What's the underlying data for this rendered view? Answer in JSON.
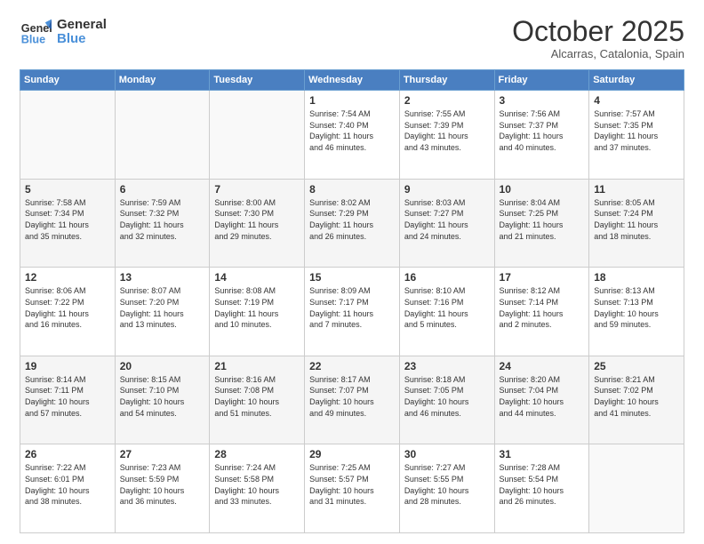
{
  "logo": {
    "line1": "General",
    "line2": "Blue"
  },
  "header": {
    "month": "October 2025",
    "location": "Alcarras, Catalonia, Spain"
  },
  "weekdays": [
    "Sunday",
    "Monday",
    "Tuesday",
    "Wednesday",
    "Thursday",
    "Friday",
    "Saturday"
  ],
  "weeks": [
    [
      {
        "day": "",
        "info": ""
      },
      {
        "day": "",
        "info": ""
      },
      {
        "day": "",
        "info": ""
      },
      {
        "day": "1",
        "info": "Sunrise: 7:54 AM\nSunset: 7:40 PM\nDaylight: 11 hours\nand 46 minutes."
      },
      {
        "day": "2",
        "info": "Sunrise: 7:55 AM\nSunset: 7:39 PM\nDaylight: 11 hours\nand 43 minutes."
      },
      {
        "day": "3",
        "info": "Sunrise: 7:56 AM\nSunset: 7:37 PM\nDaylight: 11 hours\nand 40 minutes."
      },
      {
        "day": "4",
        "info": "Sunrise: 7:57 AM\nSunset: 7:35 PM\nDaylight: 11 hours\nand 37 minutes."
      }
    ],
    [
      {
        "day": "5",
        "info": "Sunrise: 7:58 AM\nSunset: 7:34 PM\nDaylight: 11 hours\nand 35 minutes."
      },
      {
        "day": "6",
        "info": "Sunrise: 7:59 AM\nSunset: 7:32 PM\nDaylight: 11 hours\nand 32 minutes."
      },
      {
        "day": "7",
        "info": "Sunrise: 8:00 AM\nSunset: 7:30 PM\nDaylight: 11 hours\nand 29 minutes."
      },
      {
        "day": "8",
        "info": "Sunrise: 8:02 AM\nSunset: 7:29 PM\nDaylight: 11 hours\nand 26 minutes."
      },
      {
        "day": "9",
        "info": "Sunrise: 8:03 AM\nSunset: 7:27 PM\nDaylight: 11 hours\nand 24 minutes."
      },
      {
        "day": "10",
        "info": "Sunrise: 8:04 AM\nSunset: 7:25 PM\nDaylight: 11 hours\nand 21 minutes."
      },
      {
        "day": "11",
        "info": "Sunrise: 8:05 AM\nSunset: 7:24 PM\nDaylight: 11 hours\nand 18 minutes."
      }
    ],
    [
      {
        "day": "12",
        "info": "Sunrise: 8:06 AM\nSunset: 7:22 PM\nDaylight: 11 hours\nand 16 minutes."
      },
      {
        "day": "13",
        "info": "Sunrise: 8:07 AM\nSunset: 7:20 PM\nDaylight: 11 hours\nand 13 minutes."
      },
      {
        "day": "14",
        "info": "Sunrise: 8:08 AM\nSunset: 7:19 PM\nDaylight: 11 hours\nand 10 minutes."
      },
      {
        "day": "15",
        "info": "Sunrise: 8:09 AM\nSunset: 7:17 PM\nDaylight: 11 hours\nand 7 minutes."
      },
      {
        "day": "16",
        "info": "Sunrise: 8:10 AM\nSunset: 7:16 PM\nDaylight: 11 hours\nand 5 minutes."
      },
      {
        "day": "17",
        "info": "Sunrise: 8:12 AM\nSunset: 7:14 PM\nDaylight: 11 hours\nand 2 minutes."
      },
      {
        "day": "18",
        "info": "Sunrise: 8:13 AM\nSunset: 7:13 PM\nDaylight: 10 hours\nand 59 minutes."
      }
    ],
    [
      {
        "day": "19",
        "info": "Sunrise: 8:14 AM\nSunset: 7:11 PM\nDaylight: 10 hours\nand 57 minutes."
      },
      {
        "day": "20",
        "info": "Sunrise: 8:15 AM\nSunset: 7:10 PM\nDaylight: 10 hours\nand 54 minutes."
      },
      {
        "day": "21",
        "info": "Sunrise: 8:16 AM\nSunset: 7:08 PM\nDaylight: 10 hours\nand 51 minutes."
      },
      {
        "day": "22",
        "info": "Sunrise: 8:17 AM\nSunset: 7:07 PM\nDaylight: 10 hours\nand 49 minutes."
      },
      {
        "day": "23",
        "info": "Sunrise: 8:18 AM\nSunset: 7:05 PM\nDaylight: 10 hours\nand 46 minutes."
      },
      {
        "day": "24",
        "info": "Sunrise: 8:20 AM\nSunset: 7:04 PM\nDaylight: 10 hours\nand 44 minutes."
      },
      {
        "day": "25",
        "info": "Sunrise: 8:21 AM\nSunset: 7:02 PM\nDaylight: 10 hours\nand 41 minutes."
      }
    ],
    [
      {
        "day": "26",
        "info": "Sunrise: 7:22 AM\nSunset: 6:01 PM\nDaylight: 10 hours\nand 38 minutes."
      },
      {
        "day": "27",
        "info": "Sunrise: 7:23 AM\nSunset: 5:59 PM\nDaylight: 10 hours\nand 36 minutes."
      },
      {
        "day": "28",
        "info": "Sunrise: 7:24 AM\nSunset: 5:58 PM\nDaylight: 10 hours\nand 33 minutes."
      },
      {
        "day": "29",
        "info": "Sunrise: 7:25 AM\nSunset: 5:57 PM\nDaylight: 10 hours\nand 31 minutes."
      },
      {
        "day": "30",
        "info": "Sunrise: 7:27 AM\nSunset: 5:55 PM\nDaylight: 10 hours\nand 28 minutes."
      },
      {
        "day": "31",
        "info": "Sunrise: 7:28 AM\nSunset: 5:54 PM\nDaylight: 10 hours\nand 26 minutes."
      },
      {
        "day": "",
        "info": ""
      }
    ]
  ]
}
